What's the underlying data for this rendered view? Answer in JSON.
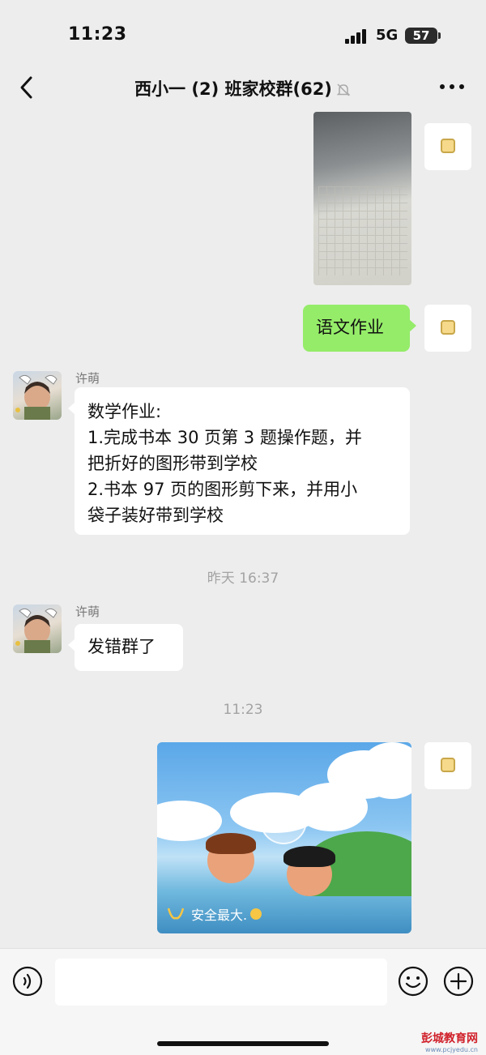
{
  "status_bar": {
    "time": "11:23",
    "network": "5G",
    "battery": "57"
  },
  "nav": {
    "title": "西小一 (2) 班家校群(62)",
    "back_icon": "chevron-left-icon",
    "mute_icon": "bell-off-icon",
    "more_icon": "more-horizontal-icon"
  },
  "messages": {
    "self_text": "语文作业",
    "other_name": "许萌",
    "math_lines": [
      "数学作业:",
      "1.完成书本 30 页第 3 题操作题，并",
      "把折好的图形带到学校",
      "2.书本 97 页的图形剪下来，并用小",
      "袋子装好带到学校"
    ],
    "time_yesterday": "昨天 16:37",
    "wrong_group": "发错群了",
    "time_today": "11:23",
    "video_caption": "安全最大."
  },
  "input_bar": {
    "voice_icon": "voice-icon",
    "emoji_icon": "emoji-icon",
    "plus_icon": "plus-circle-icon"
  },
  "watermark": {
    "title": "彭城教育网",
    "url": "www.pcjyedu.cn"
  },
  "colors": {
    "background": "#ededed",
    "bubble_self": "#95ec69",
    "bubble_other": "#ffffff",
    "timestamp": "#a3a3a3"
  }
}
